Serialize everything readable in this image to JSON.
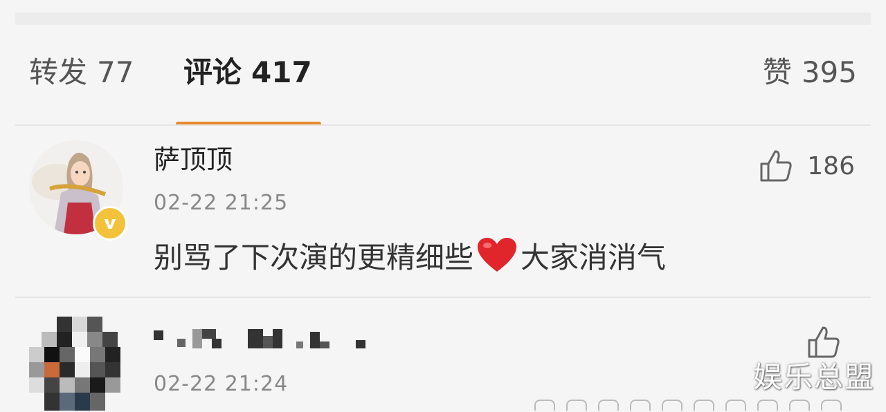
{
  "tabs": {
    "repost": {
      "label": "转发",
      "count": "77"
    },
    "comment": {
      "label": "评论",
      "count": "417"
    },
    "like": {
      "label": "赞",
      "count": "395"
    }
  },
  "comments": [
    {
      "username": "萨顶顶",
      "time": "02-22 21:25",
      "text_before": "别骂了下次演的更精细些",
      "emoji": "heart-emoji",
      "text_after": "大家消消气",
      "likes": "186",
      "verified": true
    },
    {
      "username_masked": true,
      "time": "02-22 21:24",
      "likes": ""
    }
  ],
  "watermark": "娱乐总盟",
  "colors": {
    "accent": "#e8892c",
    "badge": "#f4c23a",
    "heart": "#e0252b"
  }
}
